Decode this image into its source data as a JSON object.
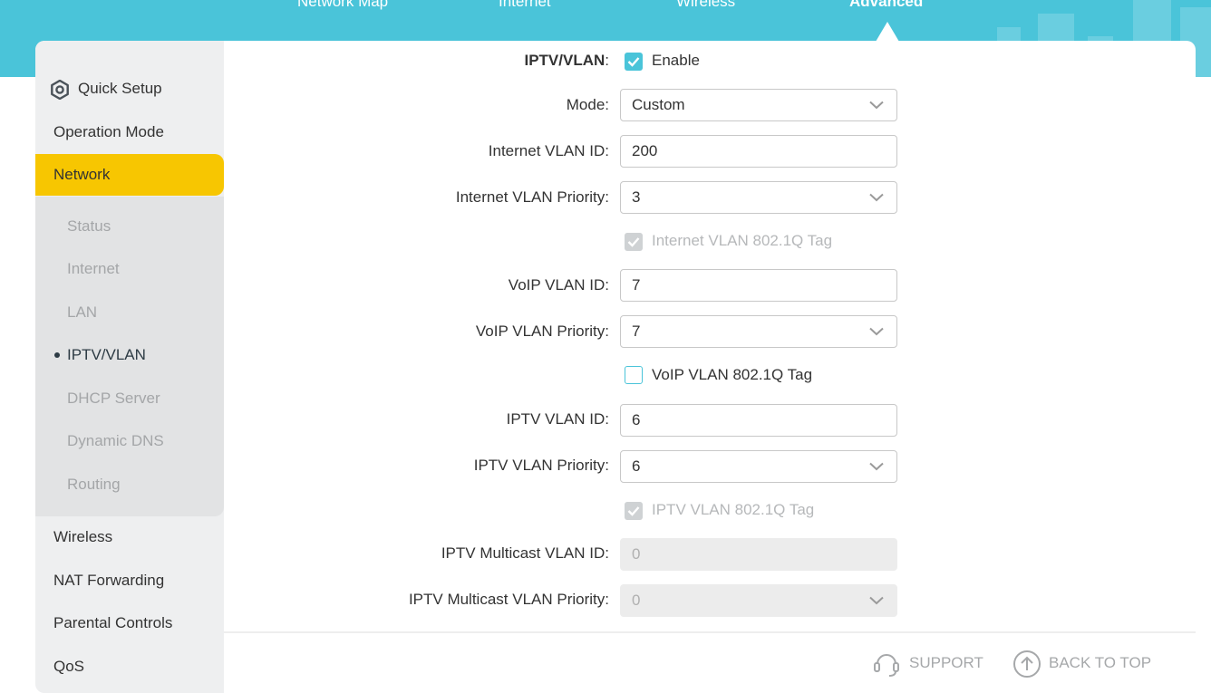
{
  "top_nav": {
    "tabs": [
      {
        "label": "Network Map"
      },
      {
        "label": "Internet"
      },
      {
        "label": "Wireless"
      },
      {
        "label": "Advanced",
        "active": true
      }
    ]
  },
  "colors": {
    "accent": "#4ac4d9",
    "active_nav": "#f7c601",
    "sidebar_bg": "#eeeff0",
    "submenu_bg": "#e2e3e4"
  },
  "sidebar": {
    "items": [
      {
        "label": "Quick Setup",
        "icon": "gear-icon"
      },
      {
        "label": "Operation Mode"
      },
      {
        "label": "Network",
        "active": true
      },
      {
        "label": "Wireless"
      },
      {
        "label": "NAT Forwarding"
      },
      {
        "label": "Parental Controls"
      },
      {
        "label": "QoS"
      }
    ],
    "network_submenu": [
      {
        "label": "Status"
      },
      {
        "label": "Internet"
      },
      {
        "label": "LAN"
      },
      {
        "label": "IPTV/VLAN",
        "current": true
      },
      {
        "label": "DHCP Server"
      },
      {
        "label": "Dynamic DNS"
      },
      {
        "label": "Routing"
      }
    ]
  },
  "form": {
    "iptv_vlan": {
      "label": "IPTV/VLAN",
      "checkbox_label": "Enable",
      "checked": true
    },
    "mode": {
      "label": "Mode:",
      "value": "Custom"
    },
    "internet_vlan_id": {
      "label": "Internet VLAN ID:",
      "value": "200"
    },
    "internet_vlan_priority": {
      "label": "Internet VLAN Priority:",
      "value": "3"
    },
    "internet_tag": {
      "label": "Internet VLAN 802.1Q Tag",
      "checked": true,
      "disabled": true
    },
    "voip_vlan_id": {
      "label": "VoIP VLAN ID:",
      "value": "7"
    },
    "voip_vlan_priority": {
      "label": "VoIP VLAN Priority:",
      "value": "7"
    },
    "voip_tag": {
      "label": "VoIP VLAN 802.1Q Tag",
      "checked": false
    },
    "iptv_vlan_id": {
      "label": "IPTV VLAN ID:",
      "value": "6"
    },
    "iptv_vlan_priority": {
      "label": "IPTV VLAN Priority:",
      "value": "6"
    },
    "iptv_tag": {
      "label": "IPTV VLAN 802.1Q Tag",
      "checked": true,
      "disabled": true
    },
    "iptv_multicast_vlan_id": {
      "label": "IPTV Multicast VLAN ID:",
      "value": "0"
    },
    "iptv_multicast_vlan_priority": {
      "label": "IPTV Multicast VLAN Priority:",
      "value": "0"
    }
  },
  "footer": {
    "support": "SUPPORT",
    "back_to_top": "BACK TO TOP"
  }
}
